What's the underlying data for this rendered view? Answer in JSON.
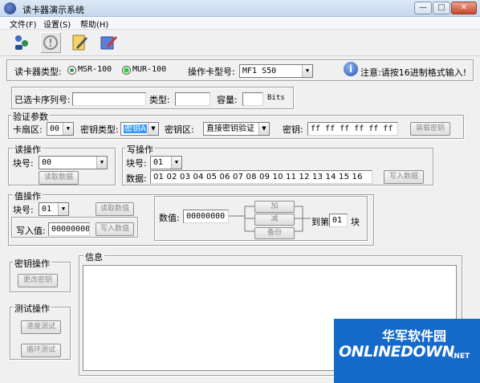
{
  "window": {
    "title": "读卡器演示系统",
    "minimize": "—",
    "maximize": "□",
    "close": "✕"
  },
  "menu": {
    "items": [
      "文件(F)",
      "设置(S)",
      "帮助(H)"
    ]
  },
  "toolbar": {
    "icons": [
      "connect-icon",
      "stop-icon",
      "notepad-icon",
      "write-icon"
    ]
  },
  "reader": {
    "type_label": "读卡器类型:",
    "msr": "MSR-100",
    "mur": "MUR-100",
    "selected": "MUR-100",
    "op_label": "操作卡型号:",
    "op_value": "MF1 S50",
    "notice": "注意:请按16进制格式输入!"
  },
  "selected_card": {
    "serial_label": "已选卡序列号:",
    "serial_value": "",
    "type_label": "类型:",
    "type_value": "",
    "capacity_label": "容量:",
    "capacity_value": "",
    "unit": "Bits"
  },
  "auth": {
    "legend": "验证参数",
    "sector_label": "卡扇区:",
    "sector_value": "00",
    "keytype_label": "密钥类型:",
    "keytype_value": "密钥A",
    "keyarea_label": "密钥区:",
    "keyarea_value": "直接密钥验证",
    "key_label": "密钥:",
    "key_value": "ff ff ff ff ff ff",
    "load_button": "装载密钥"
  },
  "read": {
    "legend": "读操作",
    "block_label": "块号:",
    "block_value": "00",
    "button": "读取数据"
  },
  "write": {
    "legend": "写操作",
    "block_label": "块号:",
    "block_value": "01",
    "data_label": "数据:",
    "data_value": "01 02 03 04 05 06 07 08 09 10 11 12 13 14 15 16",
    "button": "写入数据"
  },
  "value_op": {
    "legend": "值操作",
    "block_label": "块号:",
    "block_value": "01",
    "read_button": "读取数值",
    "write_label": "写入值:",
    "write_value": "00000000",
    "write_button": "写入数值",
    "num_label": "数值:",
    "num_value": "00000000",
    "add": "加",
    "sub": "减",
    "backup": "备份",
    "to_label": "到第",
    "to_value": "01",
    "block_suffix": "块"
  },
  "key_op": {
    "legend": "密钥操作",
    "button": "更改密钥"
  },
  "test_op": {
    "legend": "测试操作",
    "speed": "速度测试",
    "loop": "循环测试"
  },
  "info": {
    "legend": "信息",
    "text": ""
  },
  "watermark": {
    "cn": "华军软件园",
    "en": "ONLINEDOWN",
    "net": ".NET"
  }
}
